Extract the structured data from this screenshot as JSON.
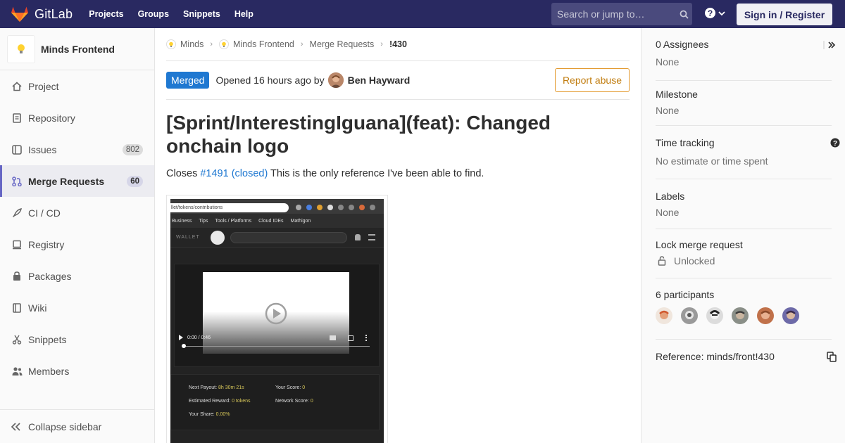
{
  "navbar": {
    "brand": "GitLab",
    "links": [
      "Projects",
      "Groups",
      "Snippets",
      "Help"
    ],
    "search_placeholder": "Search or jump to…",
    "signin": "Sign in / Register"
  },
  "sidebar": {
    "project_name": "Minds Frontend",
    "items": [
      {
        "label": "Project",
        "icon": "home-icon"
      },
      {
        "label": "Repository",
        "icon": "document-icon"
      },
      {
        "label": "Issues",
        "icon": "issues-icon",
        "count": "802"
      },
      {
        "label": "Merge Requests",
        "icon": "merge-request-icon",
        "count": "60",
        "active": true
      },
      {
        "label": "CI / CD",
        "icon": "rocket-icon"
      },
      {
        "label": "Registry",
        "icon": "server-icon"
      },
      {
        "label": "Packages",
        "icon": "package-icon"
      },
      {
        "label": "Wiki",
        "icon": "book-icon"
      },
      {
        "label": "Snippets",
        "icon": "scissors-icon"
      },
      {
        "label": "Members",
        "icon": "users-icon"
      }
    ],
    "collapse": "Collapse sidebar"
  },
  "breadcrumbs": {
    "group": "Minds",
    "project": "Minds Frontend",
    "section": "Merge Requests",
    "current": "!430"
  },
  "mr": {
    "status": "Merged",
    "opened": "Opened 16 hours ago by",
    "author": "Ben Hayward",
    "report": "Report abuse",
    "title": "[Sprint/InterestingIguana](feat): Changed onchain logo",
    "desc_prefix": "Closes ",
    "desc_link": "#1491 (closed)",
    "desc_suffix": " This is the only reference I've been able to find."
  },
  "screenshot": {
    "url": "llet/tokens/contributions",
    "bookmarks": [
      "Business",
      "Tips",
      "Tools / Platforms",
      "Cloud IDEs",
      "Mathigon"
    ],
    "wallet_label": "WALLET",
    "video_time": "0:00 / 0:46",
    "next_payout_label": "Next Payout:",
    "next_payout_value": "8h 30m 21s",
    "your_score_label": "Your Score:",
    "your_score_value": "0",
    "est_reward_label": "Estimated Reward:",
    "est_reward_value": "0 tokens",
    "network_score_label": "Network Score:",
    "network_score_value": "0",
    "your_share_label": "Your Share:",
    "your_share_value": "0.00%"
  },
  "right": {
    "assignees_title": "0 Assignees",
    "assignees_value": "None",
    "milestone_title": "Milestone",
    "milestone_value": "None",
    "time_title": "Time tracking",
    "time_value": "No estimate or time spent",
    "labels_title": "Labels",
    "labels_value": "None",
    "lock_title": "Lock merge request",
    "lock_value": "Unlocked",
    "participants_title": "6 participants",
    "reference": "Reference: minds/front!430"
  },
  "colors": {
    "navbar": "#292961",
    "accent": "#6666c4",
    "merged": "#1f78d1",
    "report": "#e39a2f"
  }
}
